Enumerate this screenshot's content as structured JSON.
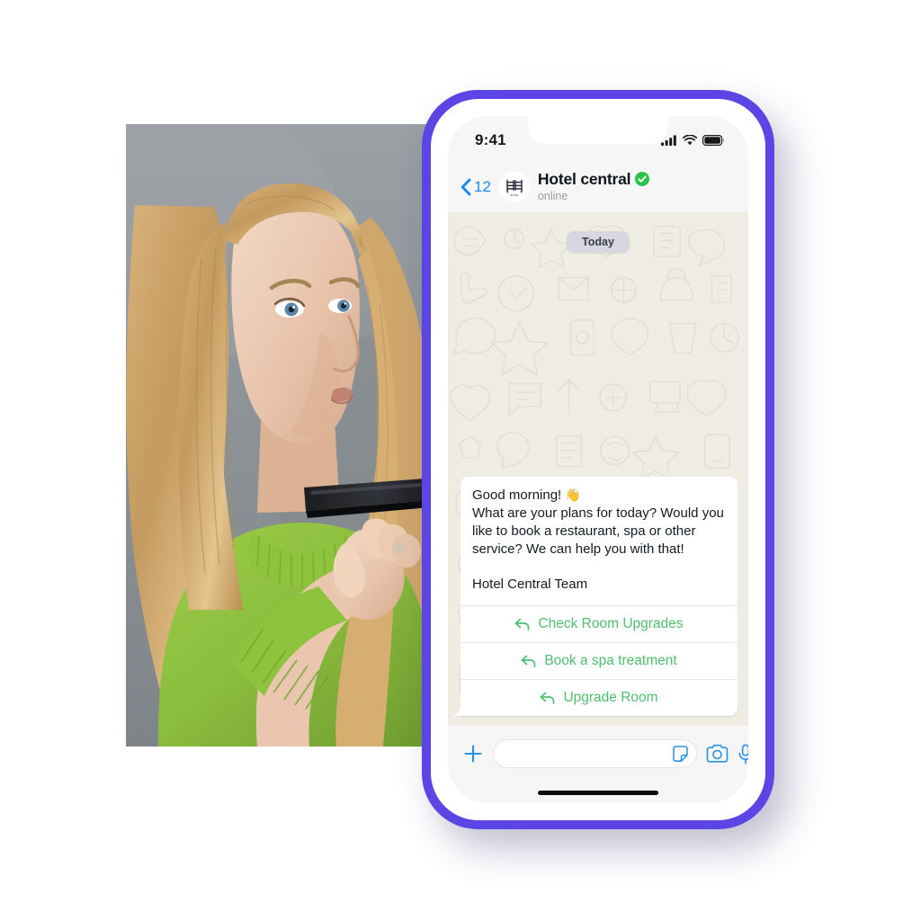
{
  "theme": {
    "phone_frame_color": "#5B46E5",
    "accent_blue": "#1C8AE8",
    "reply_green": "#4FBE6D",
    "verified_green": "#2BC44A",
    "chat_wallpaper": "#EFECE4",
    "sweater_green": "#8CBE3F",
    "wall_gray": "#8D9296"
  },
  "photo": {
    "alt": "Woman in green sweater holding phone to mouth using voice message",
    "subject": "blonde-woman-voice-message",
    "background": "gray-studio-wall"
  },
  "statusbar": {
    "time": "9:41",
    "signal_icon": "cellular-signal-icon",
    "wifi_icon": "wifi-icon",
    "battery_icon": "battery-full-icon"
  },
  "header": {
    "back_icon": "chevron-left-icon",
    "back_count": "12",
    "avatar_icon": "hotel-bunkbed-icon",
    "avatar_caption": "HOTEL",
    "title": "Hotel central",
    "verified_icon": "verified-check-icon",
    "status": "online"
  },
  "chat": {
    "day_divider": "Today",
    "message": {
      "line1": "Good morning!",
      "emoji": "👋",
      "line2": "What are your plans for today? Would you like to book a restaurant, spa or other service? We can help you with that!",
      "signature": "Hotel Central Team"
    },
    "quick_replies": [
      {
        "label": "Check Room Upgrades",
        "icon": "reply-arrow-icon"
      },
      {
        "label": "Book a spa treatment",
        "icon": "reply-arrow-icon"
      },
      {
        "label": "Upgrade Room",
        "icon": "reply-arrow-icon"
      }
    ]
  },
  "composer": {
    "plus_icon": "plus-icon",
    "input_value": "",
    "input_placeholder": "",
    "sticker_icon": "sticker-icon",
    "camera_icon": "camera-icon",
    "mic_icon": "microphone-icon"
  }
}
